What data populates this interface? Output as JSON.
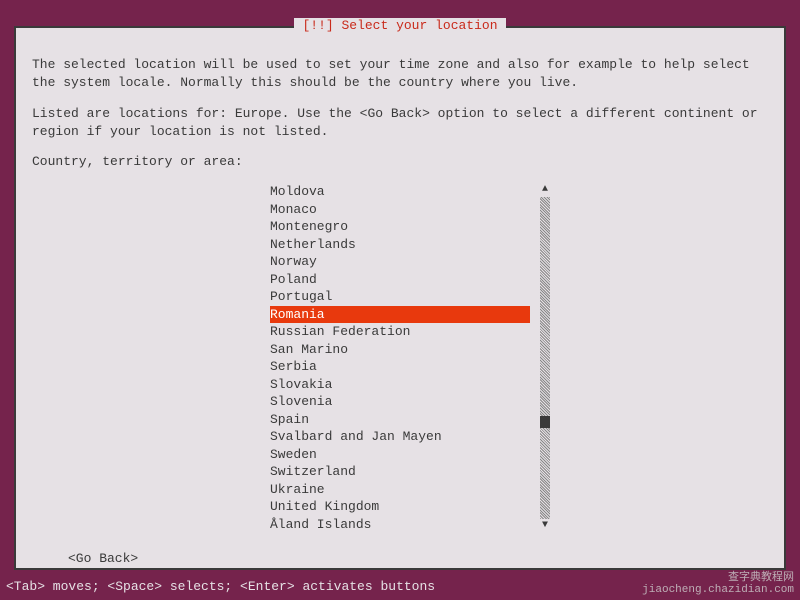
{
  "dialog": {
    "title": "[!!] Select your location",
    "help1": "The selected location will be used to set your time zone and also for example to help select the system locale. Normally this should be the country where you live.",
    "help2": "Listed are locations for: Europe. Use the <Go Back> option to select a different continent or region if your location is not listed.",
    "prompt": "Country, territory or area:",
    "countries": [
      "Moldova",
      "Monaco",
      "Montenegro",
      "Netherlands",
      "Norway",
      "Poland",
      "Portugal",
      "Romania",
      "Russian Federation",
      "San Marino",
      "Serbia",
      "Slovakia",
      "Slovenia",
      "Spain",
      "Svalbard and Jan Mayen",
      "Sweden",
      "Switzerland",
      "Ukraine",
      "United Kingdom",
      "Åland Islands"
    ],
    "selected_index": 7,
    "go_back": "<Go Back>"
  },
  "status_bar": "<Tab> moves; <Space> selects; <Enter> activates buttons",
  "watermark": {
    "line1": "查字典教程网",
    "line2": "jiaocheng.chazidian.com"
  }
}
